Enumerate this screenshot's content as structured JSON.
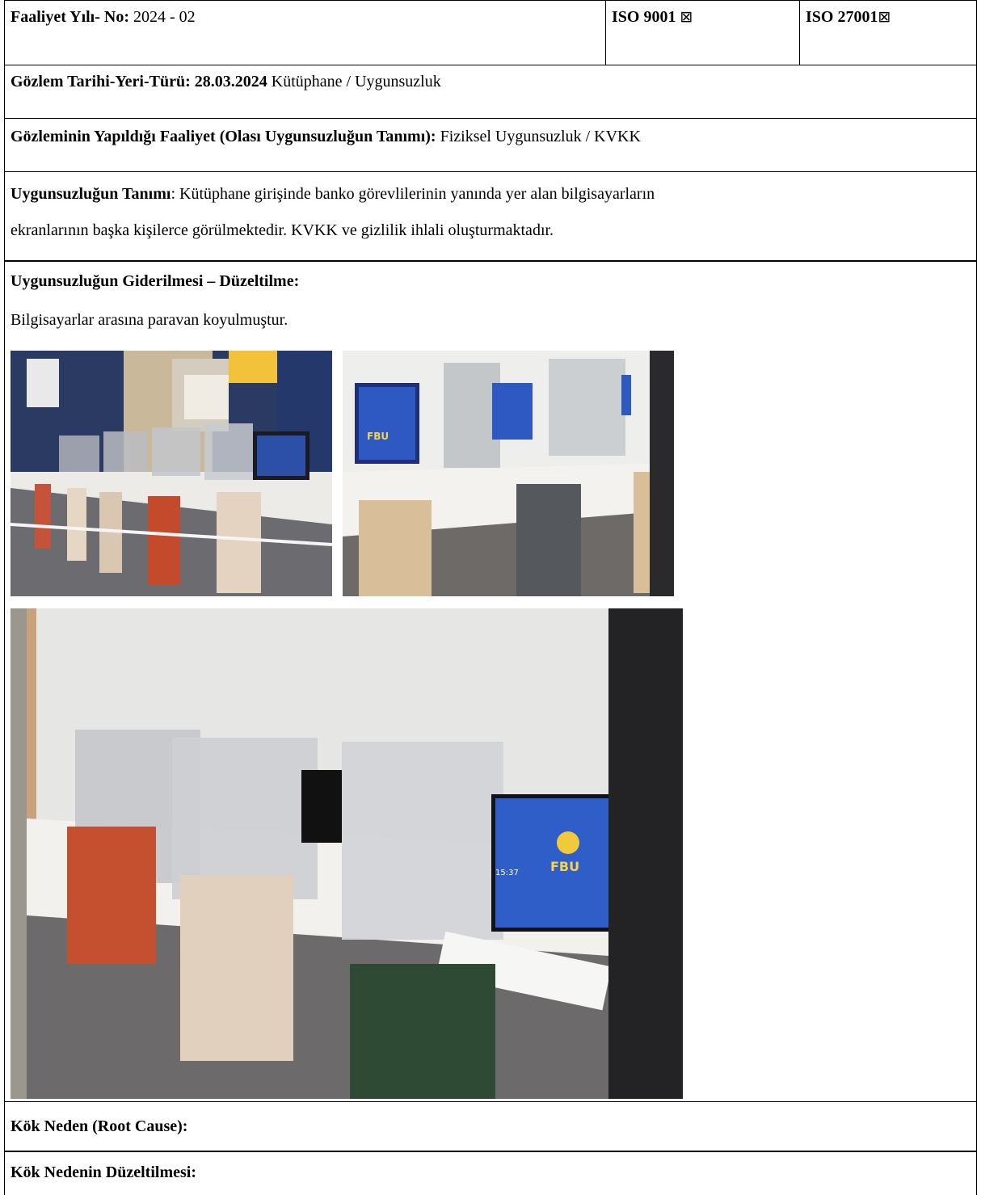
{
  "header": {
    "faaliyet_label": "Faaliyet Yılı- No:",
    "faaliyet_value": " 2024 - 02",
    "iso9001_label": "ISO 9001",
    "iso27001_label": "ISO 27001",
    "checkbox_glyph": "⊠"
  },
  "gozlem": {
    "label": "Gözlem Tarihi-Yeri-Türü:",
    "date": " 28.03.2024",
    "value": " Kütüphane / Uygunsuzluk"
  },
  "faaliyet_tanimi": {
    "label": "Gözleminin Yapıldığı Faaliyet (Olası Uygunsuzluğun Tanımı):",
    "value": " Fiziksel Uygunsuzluk / KVKK"
  },
  "uygunsuzluk_tanimi": {
    "label": "Uygunsuzluğun Tanımı",
    "line1": ": Kütüphane girişinde banko görevlilerinin yanında yer alan bilgisayarların",
    "line2": "ekranlarının başka kişilerce görülmektedir. KVKK ve gizlilik ihlali oluşturmaktadır."
  },
  "duzeltme": {
    "label": "Uygunsuzluğun Giderilmesi – Düzeltilme:",
    "text": "Bilgisayarlar arasına paravan koyulmuştur.",
    "photo_badge": "FBU",
    "photo_time": "15:37"
  },
  "kok_neden": {
    "label": "Kök Neden (Root Cause):"
  },
  "kok_neden_duzeltme": {
    "label": "Kök Nedenin Düzeltilmesi:"
  }
}
